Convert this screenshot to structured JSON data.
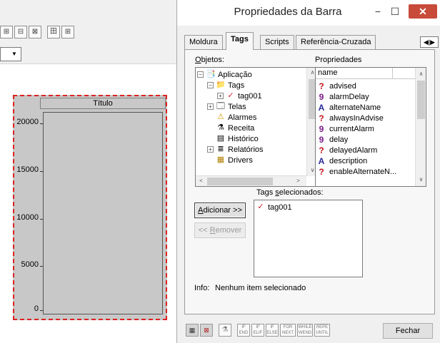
{
  "background": {
    "toolbar": {
      "buttons_group1": [
        "⊞",
        "⊟",
        "⊠"
      ],
      "buttons_group2": [
        "田",
        "⊞"
      ],
      "combo_arrow": "▼"
    },
    "chart": {
      "title": "Título",
      "y_ticks": [
        "20000",
        "15000",
        "10000",
        "5000",
        "0"
      ]
    }
  },
  "dialog": {
    "title": "Propriedades da Barra",
    "window_controls": {
      "minimize": "−",
      "maximize": "☐",
      "close": "✕"
    },
    "tabs": [
      {
        "label": "Moldura"
      },
      {
        "label": "Tags"
      },
      {
        "label": "Scripts"
      },
      {
        "label": "Referência-Cruzada"
      }
    ],
    "tab_scroll": "◀|▶",
    "objects": {
      "label_underlined": "O",
      "label_rest": "bjetos:",
      "tree": [
        {
          "label": "Aplicação",
          "icon": "📑"
        },
        {
          "label": "Tags",
          "icon": "📁"
        },
        {
          "label": "tag001",
          "icon": "✓"
        },
        {
          "label": "Telas",
          "icon": "🗔"
        },
        {
          "label": "Alarmes",
          "icon": "⚠"
        },
        {
          "label": "Receita",
          "icon": "⚗"
        },
        {
          "label": "Histórico",
          "icon": "▤"
        },
        {
          "label": "Relatórios",
          "icon": "≣"
        },
        {
          "label": "Drivers",
          "icon": "▦"
        }
      ]
    },
    "properties": {
      "label": "Propriedades",
      "header": "name",
      "items": [
        {
          "label": "advised",
          "icon": "?"
        },
        {
          "label": "alarmDelay",
          "icon": "9"
        },
        {
          "label": "alternateName",
          "icon": "A"
        },
        {
          "label": "alwaysInAdvise",
          "icon": "?"
        },
        {
          "label": "currentAlarm",
          "icon": "9"
        },
        {
          "label": "delay",
          "icon": "9"
        },
        {
          "label": "delayedAlarm",
          "icon": "?"
        },
        {
          "label": "description",
          "icon": "A"
        },
        {
          "label": "enableAlternateN...",
          "icon": "?"
        }
      ]
    },
    "selected": {
      "label_pre": "Tags ",
      "label_underlined": "s",
      "label_post": "elecionados:",
      "items": [
        {
          "label": "tag001"
        }
      ]
    },
    "add_button": {
      "label_underlined": "A",
      "label_rest": "dicionar >>"
    },
    "remove_button": {
      "label_pre": "<< ",
      "label_underlined": "R",
      "label_rest": "emover"
    },
    "info": {
      "label": "Info:",
      "value": "Nenhum item selecionado"
    },
    "bottom_icons": [
      "▦",
      "⊠",
      "⚗",
      "IF END",
      "IF ELIF",
      "IF ELSE",
      "FOR NEXT",
      "WHILE WEND",
      "REPE UNTIL"
    ],
    "close_button": "Fechar",
    "colors": {
      "close_red": "#c84b3a",
      "chart_border": "#dd2222",
      "tag_check": "#d0202a",
      "prop_bool": "#c0141c",
      "prop_num": "#7a1a8a",
      "prop_str": "#2a2a9a"
    }
  }
}
